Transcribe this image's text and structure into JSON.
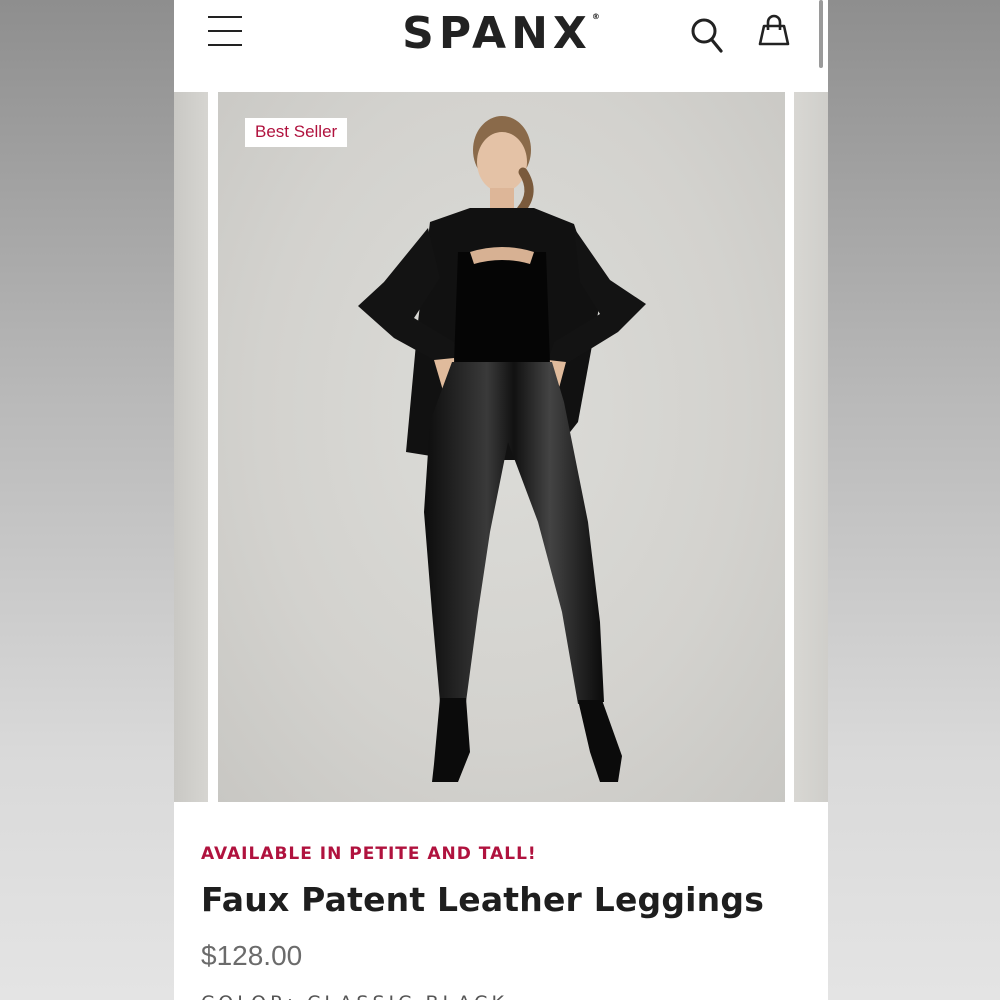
{
  "header": {
    "brand": "SPANX",
    "trademark": "®",
    "icons": [
      "menu-icon",
      "search-icon",
      "shopping-bag-icon"
    ]
  },
  "gallery": {
    "badge": "Best Seller",
    "colors": {
      "badge_text": "#b0123e",
      "background": "#d3d2ce"
    }
  },
  "product": {
    "promo": "AVAILABLE IN PETITE AND TALL!",
    "title": "Faux Patent Leather Leggings",
    "price": "$128.00",
    "color_label": "COLOR: CLASSIC BLACK"
  },
  "colors": {
    "accent": "#b0123e",
    "text": "#1e1e1e",
    "price": "#6b6b6b"
  }
}
